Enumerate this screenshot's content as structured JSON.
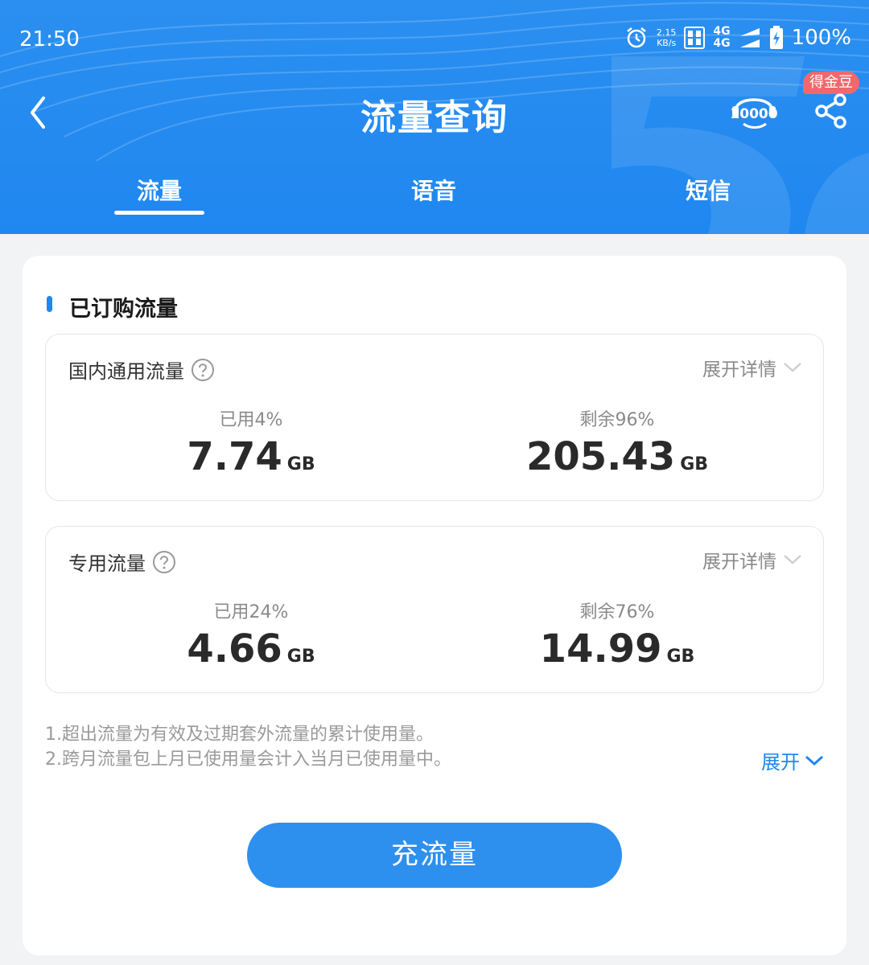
{
  "status_bar": {
    "time": "21:50",
    "net_speed_value": "2.15",
    "net_speed_unit": "KB/s",
    "signal_top": "4G",
    "signal_bottom": "4G",
    "battery": "100%"
  },
  "header": {
    "title": "流量查询",
    "coin_badge": "得金豆",
    "icons": [
      "back-arrow-icon",
      "service-10000-icon",
      "share-icon"
    ]
  },
  "tabs": [
    {
      "label": "流量",
      "active": true
    },
    {
      "label": "语音",
      "active": false
    },
    {
      "label": "短信",
      "active": false
    }
  ],
  "section": {
    "title": "已订购流量"
  },
  "packages": [
    {
      "name": "国内通用流量",
      "expand_label": "展开详情",
      "used_label": "已用4%",
      "used_value": "7.74",
      "used_unit": "GB",
      "remain_label": "剩余96%",
      "remain_value": "205.43",
      "remain_unit": "GB"
    },
    {
      "name": "专用流量",
      "expand_label": "展开详情",
      "used_label": "已用24%",
      "used_value": "4.66",
      "used_unit": "GB",
      "remain_label": "剩余76%",
      "remain_value": "14.99",
      "remain_unit": "GB"
    }
  ],
  "notes": [
    "1.超出流量为有效及过期套外流量的累计使用量。",
    "2.跨月流量包上月已使用量会计入当月已使用量中。"
  ],
  "expand_link": "展开",
  "recharge_button": "充流量",
  "colors": {
    "brand": "#1e88f0",
    "badge": "#f0686c",
    "background": "#f2f3f5"
  }
}
